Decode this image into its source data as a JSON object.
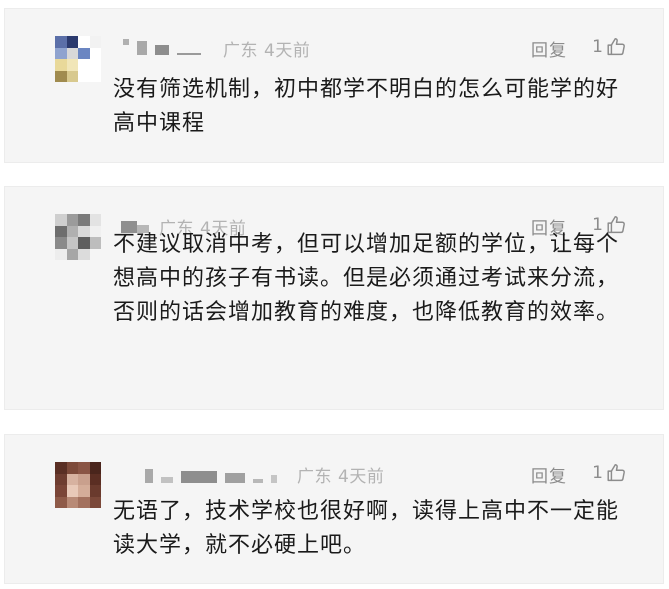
{
  "comments": [
    {
      "location": "广东",
      "time": "4天前",
      "reply_label": "回复",
      "like_count": "1",
      "text": "没有筛选机制，初中都学不明白的怎么可能学的好高中课程",
      "avatar_colors": [
        "#5b6fa8",
        "#2b3a6e",
        "#ffffff",
        "#f2f2f2",
        "#8fa3cf",
        "#d8d8d8",
        "#6b86c2",
        "#ffffff",
        "#e9d99a",
        "#f1e6b8",
        "#ffffff",
        "#ffffff",
        "#a08b4f",
        "#d8c98e",
        "#ffffff",
        "#ffffff"
      ]
    },
    {
      "location": "广东",
      "time": "4天前",
      "reply_label": "回复",
      "like_count": "1",
      "text": "不建议取消中考，但可以增加足额的学位，让每个想高中的孩子有书读。但是必须通过考试来分流，否则的话会增加教育的难度，也降低教育的效率。",
      "avatar_colors": [
        "#cfcfcf",
        "#9b9b9b",
        "#7a7a7a",
        "#e3e3e3",
        "#6e6e6e",
        "#b0b0b0",
        "#d9d9d9",
        "#f0f0f0",
        "#8a8a8a",
        "#c5c5c5",
        "#5e5e5e",
        "#bdbdbd",
        "#ededed",
        "#a6a6a6",
        "#dcdcdc",
        "#f5f5f5"
      ]
    },
    {
      "location": "广东",
      "time": "4天前",
      "reply_label": "回复",
      "like_count": "1",
      "text": "无语了，技术学校也很好啊，读得上高中不一定能读大学，就不必硬上吧。",
      "avatar_colors": [
        "#5a2f24",
        "#7d4a3a",
        "#8a5545",
        "#4a251c",
        "#6e3d30",
        "#d7b2a0",
        "#c9a08d",
        "#5b2e23",
        "#7a4537",
        "#e8c9b8",
        "#d4ad99",
        "#6a3a2d",
        "#8e5a48",
        "#b88a76",
        "#a3715e",
        "#7b4839"
      ]
    }
  ]
}
